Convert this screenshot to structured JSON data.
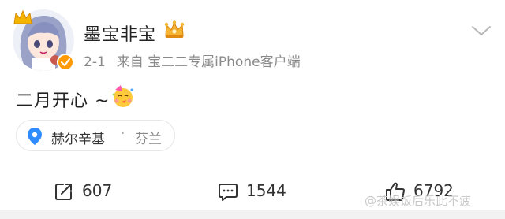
{
  "post": {
    "username": "墨宝非宝",
    "date": "2-1",
    "source": "来自 宝二二专属iPhone客户端",
    "content": "二月开心 ~"
  },
  "location": {
    "city": "赫尔辛基",
    "separator": "·",
    "country": "芬兰"
  },
  "actions": {
    "repost": "607",
    "comments": "1544",
    "likes": "6792"
  },
  "watermark": "@茶娱饭后乐此不疲",
  "icons": {
    "avatar_crown": "crown-icon",
    "vip": "vip-crown-icon",
    "verified": "verified-badge-icon",
    "more": "chevron-down-icon",
    "emoji": "party-face-emoji",
    "location": "location-pin-icon",
    "repost": "repost-icon",
    "comment": "comment-icon",
    "like": "thumbs-up-icon"
  },
  "colors": {
    "accent_blue": "#1f8fff",
    "vip_gold": "#f3a21f",
    "verified_orange": "#ff9a00",
    "meta_gray": "#8a8a8a"
  }
}
